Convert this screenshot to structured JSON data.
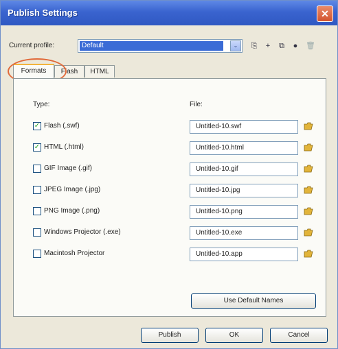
{
  "window": {
    "title": "Publish Settings",
    "close_glyph": "✕"
  },
  "profile": {
    "label": "Current profile:",
    "value": "Default",
    "arrow": "⌄"
  },
  "toolbar": {
    "icons": [
      "export-profile-icon",
      "add-profile-icon",
      "duplicate-profile-icon",
      "info-icon",
      "delete-profile-icon"
    ]
  },
  "tabs": [
    {
      "label": "Formats"
    },
    {
      "label": "Flash"
    },
    {
      "label": "HTML"
    }
  ],
  "formats": {
    "type_header": "Type:",
    "file_header": "File:",
    "rows": [
      {
        "label": "Flash  (.swf)",
        "file": "Untitled-10.swf",
        "checked": true
      },
      {
        "label": "HTML  (.html)",
        "file": "Untitled-10.html",
        "checked": true
      },
      {
        "label": "GIF Image (.gif)",
        "file": "Untitled-10.gif",
        "checked": false
      },
      {
        "label": "JPEG Image (.jpg)",
        "file": "Untitled-10.jpg",
        "checked": false
      },
      {
        "label": "PNG Image (.png)",
        "file": "Untitled-10.png",
        "checked": false
      },
      {
        "label": "Windows Projector (.exe)",
        "file": "Untitled-10.exe",
        "checked": false
      },
      {
        "label": "Macintosh Projector",
        "file": "Untitled-10.app",
        "checked": false
      }
    ],
    "use_default_names": "Use Default Names"
  },
  "footer": {
    "publish": "Publish",
    "ok": "OK",
    "cancel": "Cancel"
  },
  "colors": {
    "title_bar": "#3a64cf",
    "highlight_ring": "#e16a3a",
    "check": "#21a121",
    "folder": "#e2b43a"
  }
}
